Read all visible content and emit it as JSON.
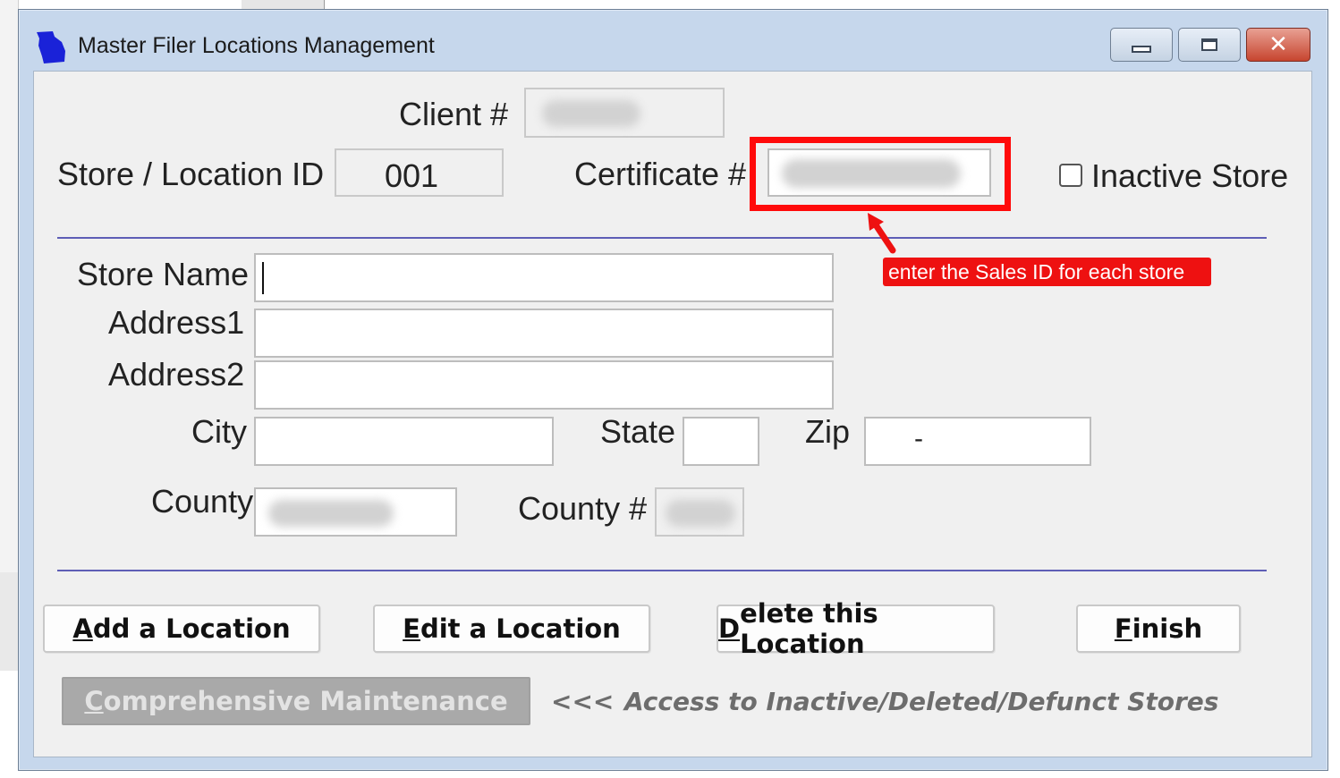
{
  "window": {
    "title": "Master Filer Locations Management",
    "controls": {
      "minimize": "minimize",
      "maximize": "maximize",
      "close": "✕"
    }
  },
  "form": {
    "client_label": "Client #",
    "store_id_label": "Store / Location ID",
    "store_id_value": "001",
    "certificate_label": "Certificate #",
    "inactive_label": "Inactive Store",
    "store_name_label": "Store Name",
    "address1_label": "Address1",
    "address2_label": "Address2",
    "city_label": "City",
    "state_label": "State",
    "zip_label": "Zip",
    "zip_value": "-",
    "county_label": "County",
    "county_num_label": "County #"
  },
  "buttons": {
    "add": {
      "accel": "A",
      "rest": "dd a Location"
    },
    "edit": {
      "accel": "E",
      "rest": "dit a Location"
    },
    "delete": {
      "accel": "D",
      "rest": "elete this Location"
    },
    "finish": {
      "accel": "F",
      "rest": "inish"
    },
    "comprehensive": {
      "accel": "C",
      "rest": "omprehensive Maintenance"
    }
  },
  "hint": {
    "arrows": "<<<",
    "text": "Access to Inactive/Deleted/Defunct Stores"
  },
  "annotation": {
    "callout_text": "enter the Sales ID for each store",
    "color": "#ee1111"
  },
  "colors": {
    "rule": "#5e5eb6",
    "titlebar": "#c6d7ec",
    "client_bg": "#f0f0f0"
  }
}
